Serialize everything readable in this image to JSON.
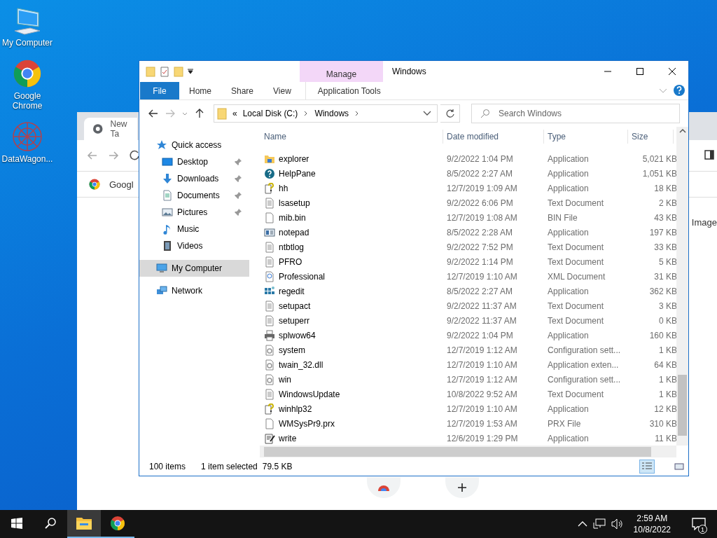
{
  "desktop": {
    "icons": [
      {
        "label": "My Computer",
        "kind": "computer"
      },
      {
        "label": "Google Chrome",
        "kind": "chrome"
      },
      {
        "label": "DataWagon...",
        "kind": "app"
      }
    ]
  },
  "browser": {
    "tab": "New Ta",
    "bookmark": "Googl",
    "side_text": "Image"
  },
  "explorer": {
    "title": "Windows",
    "context_tab": "Manage",
    "file_menu": "File",
    "ribbon_tabs": [
      {
        "label": "Home",
        "kind": "standard"
      },
      {
        "label": "Share",
        "kind": "standard"
      },
      {
        "label": "View",
        "kind": "standard"
      },
      {
        "label": "Application Tools",
        "kind": "contextual"
      }
    ],
    "address": {
      "overflow": "«",
      "crumbs": [
        "Local Disk (C:)",
        "Windows"
      ]
    },
    "search": {
      "placeholder": "Search Windows"
    },
    "nav": [
      {
        "label": "Quick access",
        "kind": "star",
        "selected": false,
        "children": [
          {
            "label": "Desktop",
            "kind": "desktop",
            "pinned": true,
            "selected": false
          },
          {
            "label": "Downloads",
            "kind": "download",
            "pinned": true,
            "selected": false
          },
          {
            "label": "Documents",
            "kind": "documents",
            "pinned": true,
            "selected": false
          },
          {
            "label": "Pictures",
            "kind": "pictures",
            "pinned": true,
            "selected": false
          },
          {
            "label": "Music",
            "kind": "music",
            "pinned": false,
            "selected": false
          },
          {
            "label": "Videos",
            "kind": "videos",
            "pinned": false,
            "selected": false
          }
        ]
      },
      {
        "label": "My Computer",
        "kind": "computer",
        "selected": true
      },
      {
        "label": "Network",
        "kind": "network",
        "selected": false
      }
    ],
    "columns": [
      "Name",
      "Date modified",
      "Type",
      "Size"
    ],
    "rows": [
      {
        "name": "explorer",
        "date": "9/2/2022 1:04 PM",
        "type": "Application",
        "size": "5,021 KB",
        "kind": "folder-app"
      },
      {
        "name": "HelpPane",
        "date": "8/5/2022 2:27 AM",
        "type": "Application",
        "size": "1,051 KB",
        "kind": "help"
      },
      {
        "name": "hh",
        "date": "12/7/2019 1:09 AM",
        "type": "Application",
        "size": "18 KB",
        "kind": "help-doc"
      },
      {
        "name": "lsasetup",
        "date": "9/2/2022 6:06 PM",
        "type": "Text Document",
        "size": "2 KB",
        "kind": "text"
      },
      {
        "name": "mib.bin",
        "date": "12/7/2019 1:08 AM",
        "type": "BIN File",
        "size": "43 KB",
        "kind": "blank"
      },
      {
        "name": "notepad",
        "date": "8/5/2022 2:28 AM",
        "type": "Application",
        "size": "197 KB",
        "kind": "window"
      },
      {
        "name": "ntbtlog",
        "date": "9/2/2022 7:52 PM",
        "type": "Text Document",
        "size": "33 KB",
        "kind": "text"
      },
      {
        "name": "PFRO",
        "date": "9/2/2022 1:14 PM",
        "type": "Text Document",
        "size": "5 KB",
        "kind": "text"
      },
      {
        "name": "Professional",
        "date": "12/7/2019 1:10 AM",
        "type": "XML Document",
        "size": "31 KB",
        "kind": "xml"
      },
      {
        "name": "regedit",
        "date": "8/5/2022 2:27 AM",
        "type": "Application",
        "size": "362 KB",
        "kind": "registry"
      },
      {
        "name": "setupact",
        "date": "9/2/2022 11:37 AM",
        "type": "Text Document",
        "size": "3 KB",
        "kind": "text"
      },
      {
        "name": "setuperr",
        "date": "9/2/2022 11:37 AM",
        "type": "Text Document",
        "size": "0 KB",
        "kind": "text"
      },
      {
        "name": "splwow64",
        "date": "9/2/2022 1:04 PM",
        "type": "Application",
        "size": "160 KB",
        "kind": "printer"
      },
      {
        "name": "system",
        "date": "12/7/2019 1:12 AM",
        "type": "Configuration sett...",
        "size": "1 KB",
        "kind": "settings"
      },
      {
        "name": "twain_32.dll",
        "date": "12/7/2019 1:10 AM",
        "type": "Application exten...",
        "size": "64 KB",
        "kind": "settings"
      },
      {
        "name": "win",
        "date": "12/7/2019 1:12 AM",
        "type": "Configuration sett...",
        "size": "1 KB",
        "kind": "settings"
      },
      {
        "name": "WindowsUpdate",
        "date": "10/8/2022 9:52 AM",
        "type": "Text Document",
        "size": "1 KB",
        "kind": "text"
      },
      {
        "name": "winhlp32",
        "date": "12/7/2019 1:10 AM",
        "type": "Application",
        "size": "12 KB",
        "kind": "help-doc"
      },
      {
        "name": "WMSysPr9.prx",
        "date": "12/7/2019 1:53 AM",
        "type": "PRX File",
        "size": "310 KB",
        "kind": "blank"
      },
      {
        "name": "write",
        "date": "12/6/2019 1:29 PM",
        "type": "Application",
        "size": "11 KB",
        "kind": "write"
      }
    ],
    "status": {
      "count": "100 items",
      "selection": "1 item selected",
      "selection_size": "79.5 KB",
      "views": [
        {
          "kind": "details",
          "selected": true
        },
        {
          "kind": "large-icons",
          "selected": false
        }
      ]
    }
  },
  "taskbar": {
    "apps": [
      {
        "kind": "explorer",
        "active": true
      },
      {
        "kind": "chrome",
        "active": false
      }
    ],
    "time": "2:59 AM",
    "date": "10/8/2022",
    "notifications": "1"
  }
}
